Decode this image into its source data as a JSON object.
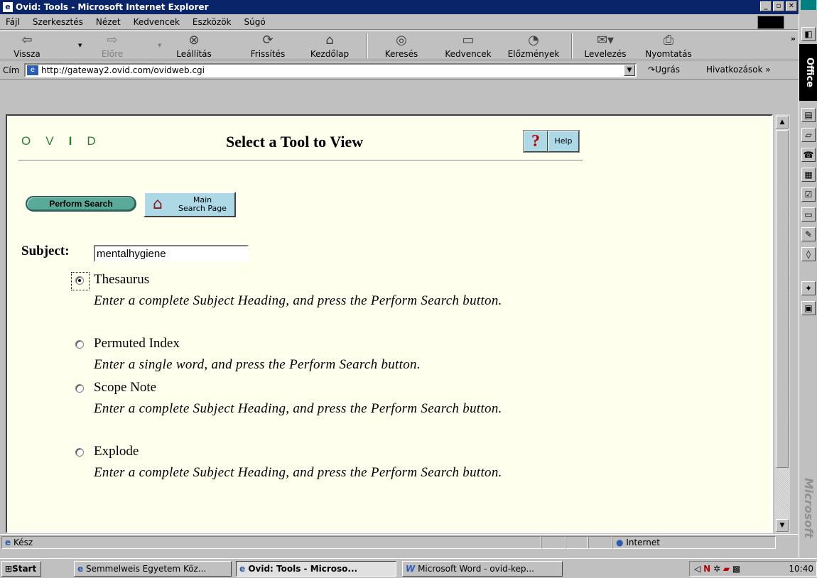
{
  "window": {
    "title": "Ovid: Tools - Microsoft Internet Explorer",
    "controls": [
      "_",
      "▫",
      "✕"
    ]
  },
  "menu": [
    "Fájl",
    "Szerkesztés",
    "Nézet",
    "Kedvencek",
    "Eszközök",
    "Súgó"
  ],
  "toolbar": {
    "back": "Vissza",
    "forward": "Előre",
    "stop": "Leállítás",
    "refresh": "Frissítés",
    "home": "Kezdőlap",
    "search": "Keresés",
    "favorites": "Kedvencek",
    "history": "Előzmények",
    "mail": "Levelezés",
    "print": "Nyomtatás",
    "more": "»"
  },
  "address": {
    "label": "Cím",
    "url": "http://gateway2.ovid.com/ovidweb.cgi",
    "go": "Ugrás",
    "links": "Hivatkozások »"
  },
  "page": {
    "logo": [
      "O",
      "V",
      "I",
      "D"
    ],
    "title": "Select a Tool to View",
    "help_icon": "?",
    "help": "Help",
    "perform_search": "Perform Search",
    "main_search_line1": "Main",
    "main_search_line2": "Search Page",
    "subject_label": "Subject:",
    "subject_value": "mentalhygiene",
    "options": [
      {
        "label": "Thesaurus",
        "desc": "Enter a complete Subject Heading, and press the Perform Search button.",
        "selected": true
      },
      {
        "label": "Permuted Index",
        "desc": "Enter a single word, and press the Perform Search button.",
        "selected": false
      },
      {
        "label": "Scope Note",
        "desc": "Enter a complete Subject Heading, and press the Perform Search button.",
        "selected": false
      },
      {
        "label": "Explode",
        "desc": "Enter a complete Subject Heading, and press the Perform Search button.",
        "selected": false
      }
    ]
  },
  "status": {
    "text": "Kész",
    "zone": "Internet"
  },
  "taskbar": {
    "start": "Start",
    "tasks": [
      "Semmelweis Egyetem Köz...",
      "Ovid: Tools - Microso...",
      "Microsoft Word - ovid-kep..."
    ],
    "time": "10:40"
  },
  "office": {
    "title": "Office",
    "brand": "Microsoft"
  },
  "icons": {
    "app": "ie-icon",
    "back": "back-arrow-icon",
    "forward": "forward-arrow-icon",
    "stop": "stop-icon",
    "refresh": "refresh-icon",
    "home": "home-icon",
    "search": "search-icon",
    "favorites": "favorites-folder-icon",
    "history": "history-icon",
    "mail": "mail-icon",
    "print": "printer-icon",
    "help": "help-question-icon",
    "house": "house-icon",
    "globe": "globe-icon"
  }
}
